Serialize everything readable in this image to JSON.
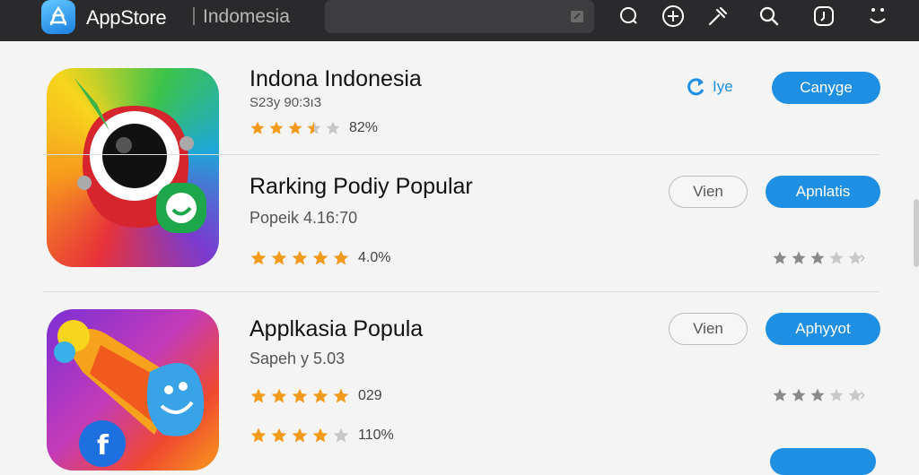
{
  "header": {
    "brand": "AppStore",
    "region": "Indomesia",
    "search_placeholder": ""
  },
  "apps": [
    {
      "title": "Indona Indonesia",
      "subtitle": "S23y 90:3ı3",
      "rating": 3.5,
      "rating_text": "82%",
      "update_label": "Iye",
      "primary_label": "Canyge"
    },
    {
      "title": "Rarking Podiy Popular",
      "subtitle": "Popeik 4.16:70",
      "rating": 5,
      "rating_text": "4.0%",
      "secondary_label": "Vien",
      "primary_label": "Apnlatis",
      "side_rating": 3
    },
    {
      "title": "Applkasia Popula",
      "subtitle": "Sapeh y 5.03",
      "rating": 5,
      "rating_text": "029",
      "rating2": 4,
      "rating2_text": "110%",
      "secondary_label": "Vien",
      "primary_label": "Aphyyot",
      "side_rating": 3
    }
  ],
  "colors": {
    "accent": "#1e8fe3",
    "star": "#f29a1b",
    "topbar": "#2a2a2c"
  }
}
